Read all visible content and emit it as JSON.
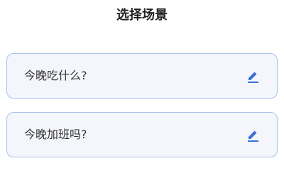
{
  "header": {
    "title": "选择场景"
  },
  "scenes": [
    {
      "label": "今晚吃什么?",
      "icon": "edit-icon"
    },
    {
      "label": "今晚加班吗?",
      "icon": "edit-icon"
    }
  ],
  "colors": {
    "accent": "#3b6fd9",
    "card_border": "#a9c1ec",
    "card_background": "#f4f6fc"
  }
}
